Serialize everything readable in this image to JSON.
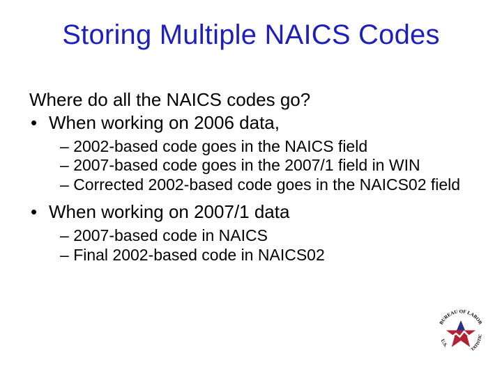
{
  "title": "Storing Multiple NAICS Codes",
  "intro": "Where do all the NAICS codes go?",
  "b1": {
    "text": "When working on 2006 data,",
    "subs": [
      "2002-based code goes in the NAICS field",
      "2007-based code goes in the 2007/1 field in WIN",
      "Corrected 2002-based code goes in the NAICS02 field"
    ]
  },
  "b2": {
    "text": "When working on 2007/1 data",
    "subs": [
      "2007-based code in NAICS",
      "Final 2002-based code in NAICS02"
    ]
  },
  "logo": {
    "outer_text_top": "BUREAU OF LABOR",
    "outer_text_side": "U.S.",
    "outer_text_right": "STATISTICS",
    "colors": {
      "red": "#b22234",
      "blue": "#27328b",
      "white": "#ffffff"
    }
  }
}
